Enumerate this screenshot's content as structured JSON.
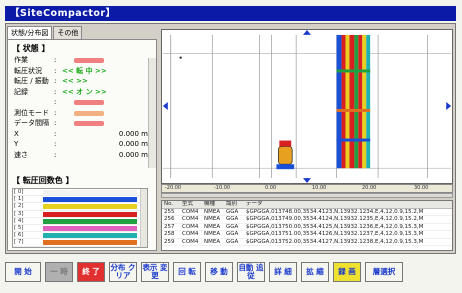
{
  "window_title": "【SiteCompactor】",
  "tabs": [
    "状態/分布図",
    "その他"
  ],
  "status": {
    "heading": "【 状態 】",
    "rows": [
      {
        "label": "作業",
        "value": "",
        "color": "r"
      },
      {
        "label": "転圧状況",
        "value": "<< 転 中 >>",
        "color": "g"
      },
      {
        "label": "転圧 / 振動",
        "value": "<<     >>",
        "color": "g"
      },
      {
        "label": "記録",
        "value": "<< オ ン >>",
        "color": "g"
      },
      {
        "label": "",
        "value": "",
        "color": "r"
      },
      {
        "label": "測位モード",
        "value": "",
        "color": "o"
      },
      {
        "label": "データ間隔",
        "value": "",
        "color": "r"
      },
      {
        "label": "X",
        "value": "0.000",
        "unit": "m"
      },
      {
        "label": "Y",
        "value": "0.000",
        "unit": "m"
      },
      {
        "label": "速さ",
        "value": "0.000",
        "unit": "m"
      }
    ]
  },
  "color_legend": {
    "heading": "【 転圧回数色 】",
    "items": [
      {
        "label": "[ 0]",
        "color": "#f2f2f2"
      },
      {
        "label": "[ 1]",
        "color": "#1a50d8"
      },
      {
        "label": "[ 2]",
        "color": "#e8d020"
      },
      {
        "label": "[ 3]",
        "color": "#d82020"
      },
      {
        "label": "[ 4]",
        "color": "#20a040"
      },
      {
        "label": "[ 5]",
        "color": "#e060c0"
      },
      {
        "label": "[ 6]",
        "color": "#20b0b0"
      },
      {
        "label": "[ 7]",
        "color": "#e07020"
      }
    ]
  },
  "ruler_labels": [
    "-20.00",
    "-10.00",
    "0.00",
    "10.00",
    "20.00",
    "30.00"
  ],
  "log": {
    "columns": [
      "No.",
      "型式",
      "機種",
      "識別",
      "データ"
    ],
    "rows": [
      [
        "255",
        "COM4",
        "NMEA",
        "GGA",
        "$GPGGA,013748.00,3534.4123,N,13932.1234,E,4,12,0.9,15.2,M"
      ],
      [
        "256",
        "COM4",
        "NMEA",
        "GGA",
        "$GPGGA,013749.00,3534.4124,N,13932.1235,E,4,12,0.9,15.2,M"
      ],
      [
        "257",
        "COM4",
        "NMEA",
        "GGA",
        "$GPGGA,013750.00,3534.4125,N,13932.1236,E,4,12,0.9,15.3,M"
      ],
      [
        "258",
        "COM4",
        "NMEA",
        "GGA",
        "$GPGGA,013751.00,3534.4126,N,13932.1237,E,4,12,0.9,15.3,M"
      ],
      [
        "259",
        "COM4",
        "NMEA",
        "GGA",
        "$GPGGA,013752.00,3534.4127,N,13932.1238,E,4,12,0.9,15.3,M"
      ]
    ]
  },
  "toolbar": [
    {
      "label": "開 始",
      "style": "normal"
    },
    {
      "label": "一 時",
      "style": "gray"
    },
    {
      "label": "終 了",
      "style": "red"
    },
    {
      "label": "分布 クリア",
      "style": "normal"
    },
    {
      "label": "表示 変更",
      "style": "normal"
    },
    {
      "label": "回 転",
      "style": "normal"
    },
    {
      "label": "移 動",
      "style": "normal"
    },
    {
      "label": "自動 追従",
      "style": "normal"
    },
    {
      "label": "詳 細",
      "style": "normal"
    },
    {
      "label": "拡 縮",
      "style": "normal"
    },
    {
      "label": "録 画",
      "style": "yellow"
    },
    {
      "label": "層選択",
      "style": "normal"
    }
  ]
}
